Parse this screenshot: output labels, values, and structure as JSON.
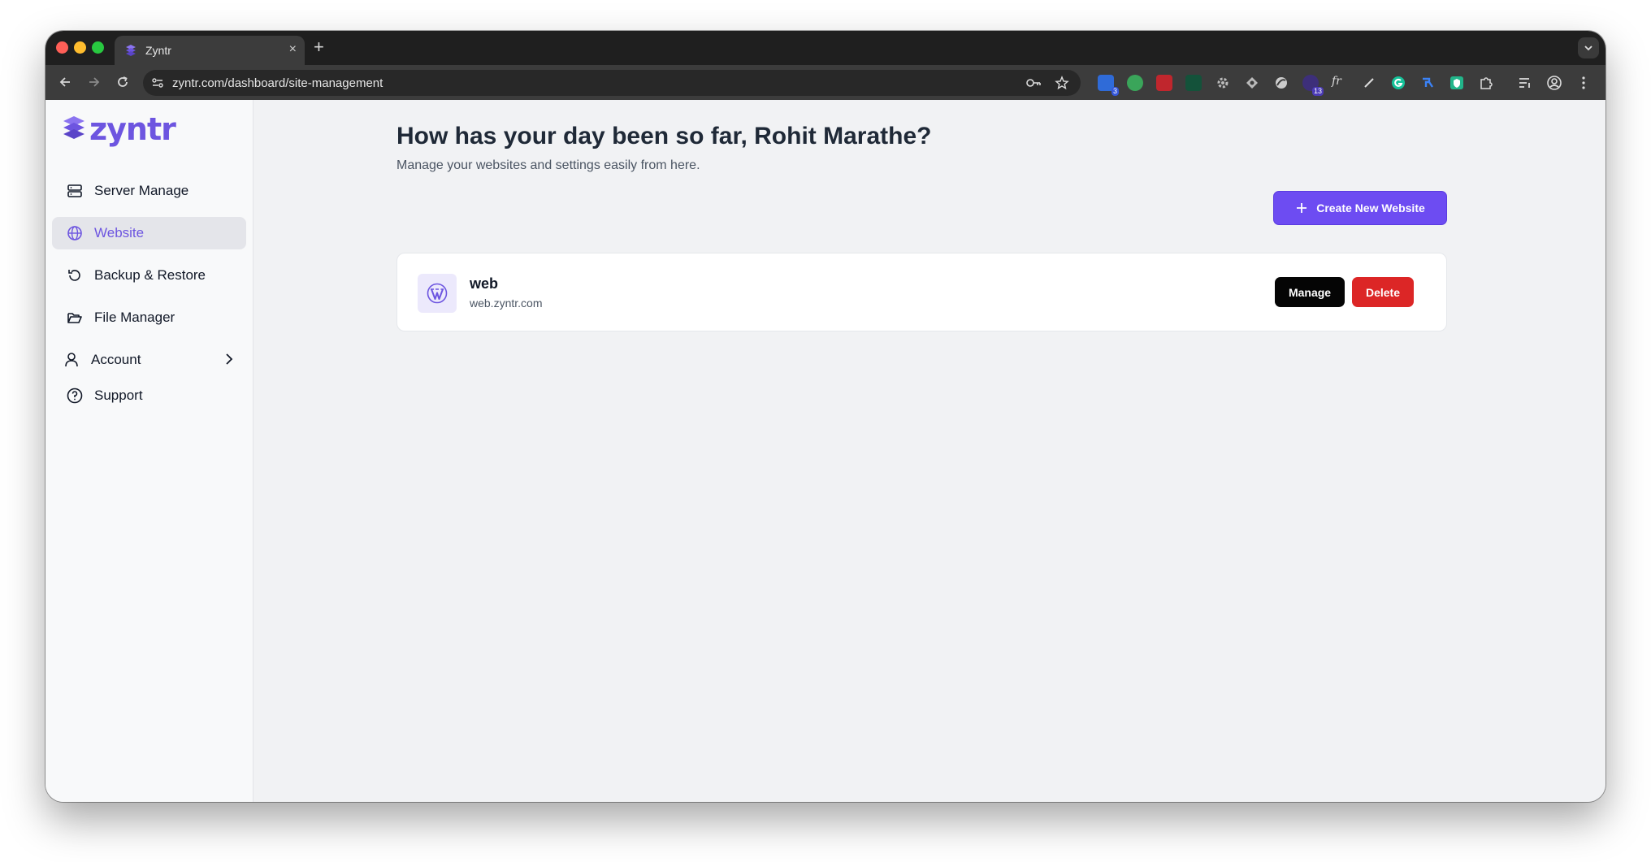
{
  "browser": {
    "tab_title": "Zyntr",
    "tab_close": "×",
    "new_tab": "+",
    "url": "zyntr.com/dashboard/site-management",
    "extension_badges": [
      "3",
      "13"
    ],
    "extension_fx": "fr"
  },
  "app": {
    "logo_text": "zyntr",
    "accent_color": "#6d55e0"
  },
  "sidebar": {
    "items": [
      {
        "label": "Server Manage",
        "icon": "server-icon"
      },
      {
        "label": "Website",
        "icon": "globe-icon",
        "active": true
      },
      {
        "label": "Backup & Restore",
        "icon": "restore-icon"
      },
      {
        "label": "File Manager",
        "icon": "folder-icon"
      },
      {
        "label": "Account",
        "icon": "user-icon",
        "has_submenu": true
      },
      {
        "label": "Support",
        "icon": "help-icon"
      }
    ]
  },
  "main": {
    "greeting": "How has your day been so far, Rohit Marathe?",
    "subtitle": "Manage your websites and settings easily from here.",
    "create_button": "Create New Website",
    "sites": [
      {
        "name": "web",
        "url": "web.zyntr.com",
        "icon": "wordpress-icon",
        "manage_label": "Manage",
        "delete_label": "Delete"
      }
    ]
  }
}
